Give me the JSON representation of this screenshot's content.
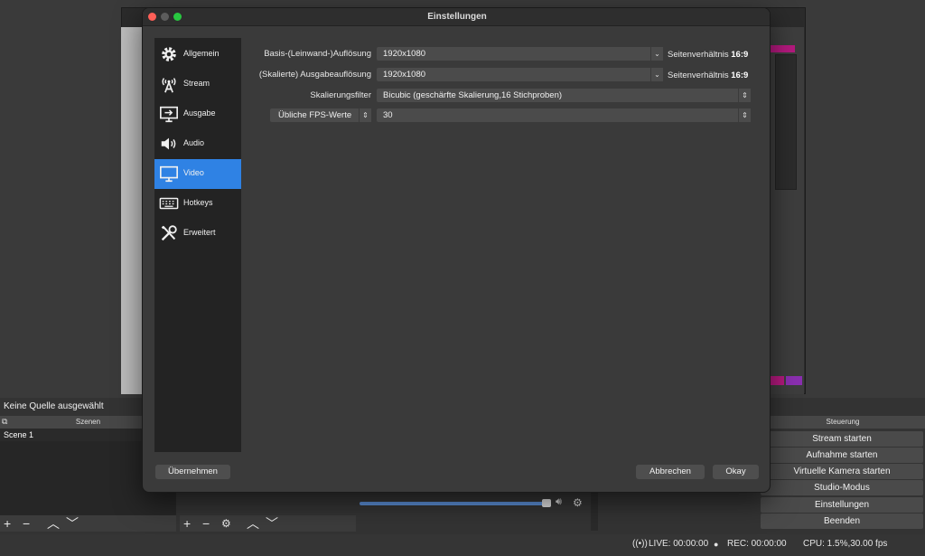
{
  "dialog": {
    "title": "Einstellungen",
    "sidebar": [
      {
        "label": "Allgemein",
        "icon": "gear-icon",
        "active": false
      },
      {
        "label": "Stream",
        "icon": "antenna-icon",
        "active": false
      },
      {
        "label": "Ausgabe",
        "icon": "output-monitor-icon",
        "active": false
      },
      {
        "label": "Audio",
        "icon": "speaker-icon",
        "active": false
      },
      {
        "label": "Video",
        "icon": "monitor-icon",
        "active": true
      },
      {
        "label": "Hotkeys",
        "icon": "keyboard-icon",
        "active": false
      },
      {
        "label": "Erweitert",
        "icon": "tools-icon",
        "active": false
      }
    ],
    "video": {
      "base_label": "Basis-(Leinwand-)Auflösung",
      "base_value": "1920x1080",
      "base_ratio_prefix": "Seitenverhältnis",
      "base_ratio": "16:9",
      "output_label": "(Skalierte) Ausgabeauflösung",
      "output_value": "1920x1080",
      "output_ratio_prefix": "Seitenverhältnis",
      "output_ratio": "16:9",
      "filter_label": "Skalierungsfilter",
      "filter_value": "Bicubic (geschärfte Skalierung,16 Stichproben)",
      "fps_type": "Übliche FPS-Werte",
      "fps_value": "30"
    },
    "buttons": {
      "apply": "Übernehmen",
      "cancel": "Abbrechen",
      "ok": "Okay"
    }
  },
  "main": {
    "no_source": "Keine Quelle ausgewählt",
    "scenes_header": "Szenen",
    "scenes": [
      "Scene 1"
    ],
    "controls_header": "Steuerung",
    "controls": [
      "Stream starten",
      "Aufnahme starten",
      "Virtuelle Kamera starten",
      "Studio-Modus",
      "Einstellungen",
      "Beenden"
    ]
  },
  "status": {
    "live": "LIVE: 00:00:00",
    "rec": "REC: 00:00:00",
    "cpu": "CPU: 1.5%,30.00 fps"
  },
  "colors": {
    "accent": "#2f82e4",
    "traffic_red": "#ff5f57",
    "traffic_yellow": "#febc2e",
    "traffic_green": "#28c840"
  }
}
